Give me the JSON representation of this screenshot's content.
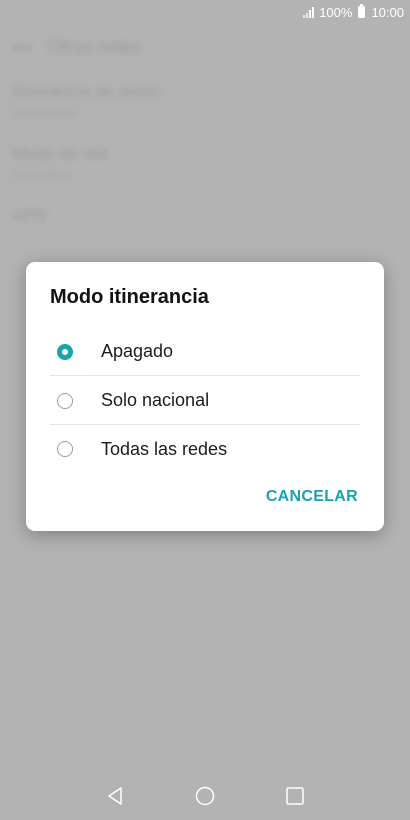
{
  "status_bar": {
    "battery": "100%",
    "time": "10:00"
  },
  "background": {
    "header_title": "Otras redes",
    "items": [
      {
        "title": "Itinerancia de datos",
        "subtitle": "Desactivado"
      },
      {
        "title": "Modo de red",
        "subtitle": "Automático"
      },
      {
        "title": "APN",
        "subtitle": ""
      }
    ]
  },
  "dialog": {
    "title": "Modo itinerancia",
    "options": [
      {
        "label": "Apagado",
        "selected": true
      },
      {
        "label": "Solo nacional",
        "selected": false
      },
      {
        "label": "Todas las redes",
        "selected": false
      }
    ],
    "cancel_label": "CANCELAR",
    "accent_color": "#17a3b0"
  },
  "nav_bar": {
    "icons": [
      "back-icon",
      "home-icon",
      "recents-icon"
    ]
  }
}
